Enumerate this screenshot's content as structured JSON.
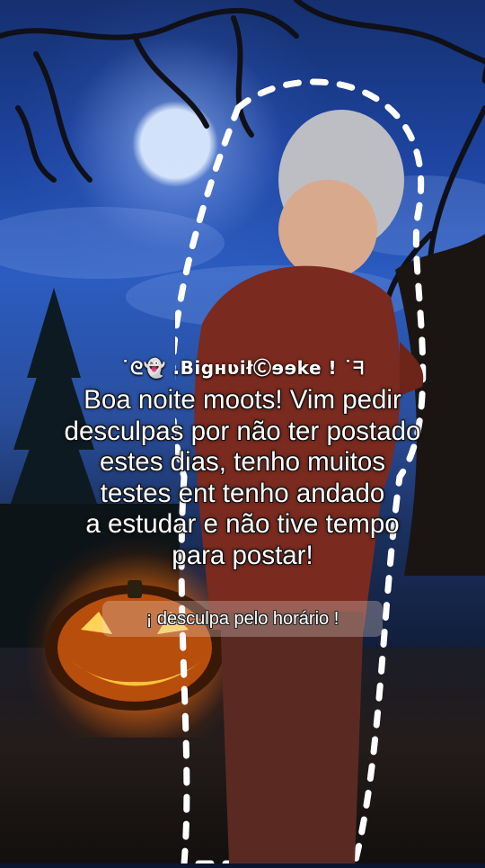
{
  "post": {
    "username": "˙ᘓ👻 .BigʜʋiłⒸɘɘke ! ˙ᖷ",
    "message": "Boa noite moots! Vim pedir\ndesculpas por não ter postado\nestes dias, tenho muitos\ntestes ent tenho andado\na estudar e não tive tempo\npara postar!",
    "apology": "¡ desculpa pelo horário !"
  },
  "colors": {
    "sky_top": "#16306f",
    "moon": "#dcebff",
    "pumpkin_glow": "#ffaa28",
    "shirt": "#7a2a1e",
    "hair": "#c8c8cc"
  }
}
